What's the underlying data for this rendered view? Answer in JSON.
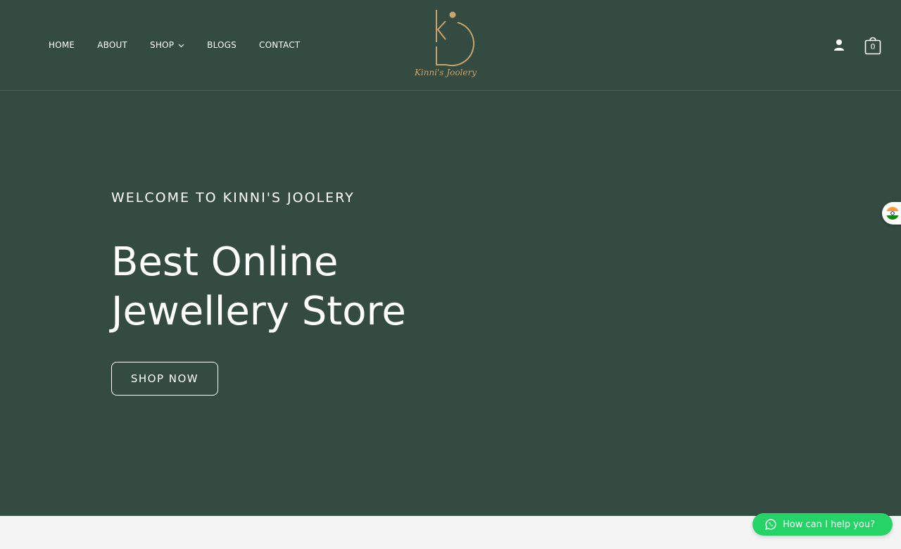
{
  "nav": {
    "items": [
      {
        "label": "HOME"
      },
      {
        "label": "ABOUT"
      },
      {
        "label": "SHOP",
        "has_dropdown": true
      },
      {
        "label": "BLOGS"
      },
      {
        "label": "CONTACT"
      }
    ]
  },
  "brand": {
    "logo_icon": "kd-monogram-icon",
    "name": "Kinni's Joolery"
  },
  "header_actions": {
    "account_icon": "user-icon",
    "cart_icon": "shopping-bag-icon",
    "cart_count": "0"
  },
  "hero": {
    "eyebrow": "WELCOME TO KINNI'S JOOLERY",
    "title_line1": "Best Online",
    "title_line2": "Jewellery Store",
    "cta_label": "SHOP NOW"
  },
  "language_switcher": {
    "icon": "india-flag-icon"
  },
  "chat_widget": {
    "icon": "whatsapp-icon",
    "label": "How can I help you?"
  },
  "colors": {
    "background_green": "#334b40",
    "gold": "#c9a36b",
    "whatsapp_green": "#25d366",
    "white": "#ffffff"
  }
}
